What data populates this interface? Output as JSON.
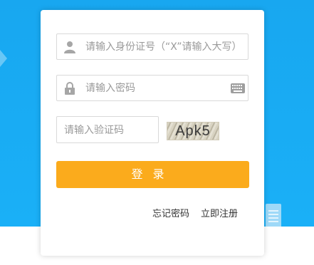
{
  "login": {
    "id_placeholder": "请输入身份证号（“X”请输入大写）",
    "password_placeholder": "请输入密码",
    "code_placeholder": "请输入验证码",
    "captcha_text": "Apk5",
    "login_button": "登录",
    "forgot_password": "忘记密码",
    "register": "立即注册"
  },
  "icons": [
    "user-icon",
    "lock-icon",
    "keyboard-icon"
  ],
  "colors": {
    "background": "#18a7f0",
    "button": "#fbab1c",
    "border": "#d9d9d9",
    "placeholder": "#9a9a9a"
  }
}
